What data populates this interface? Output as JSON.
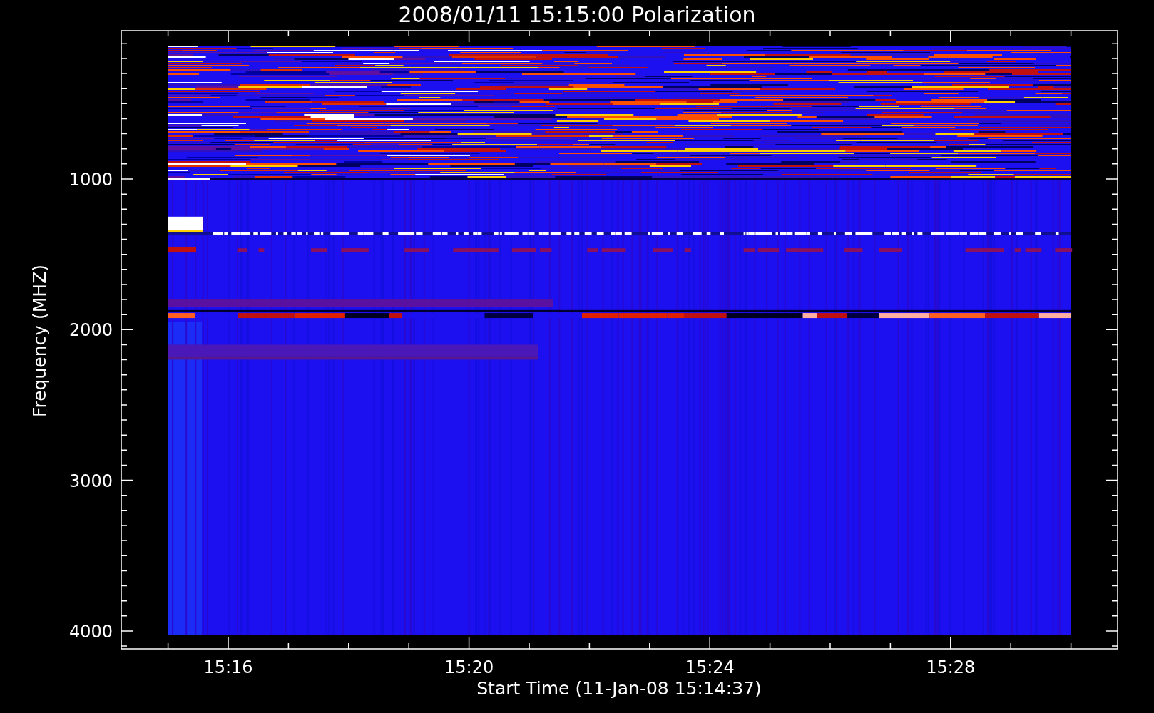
{
  "title": "2008/01/11 15:15:00 Polarization",
  "y_axis": {
    "label": "Frequency (MHZ)",
    "ticks": [
      "1000",
      "2000",
      "3000",
      "4000"
    ]
  },
  "x_axis": {
    "label": "Start Time (11-Jan-08 15:14:37)",
    "ticks": [
      "15:16",
      "15:20",
      "15:24",
      "15:28"
    ]
  }
}
